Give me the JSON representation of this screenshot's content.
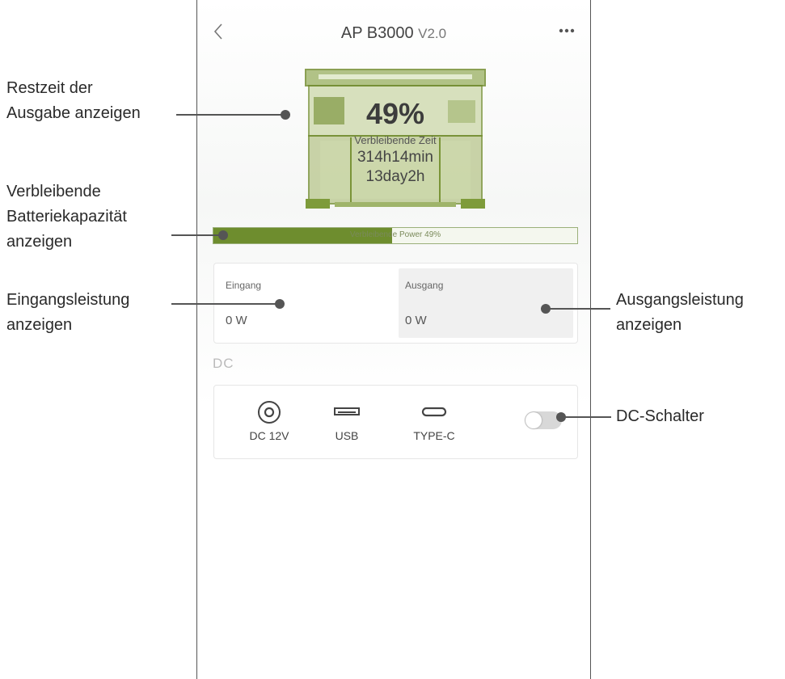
{
  "app": {
    "title": "AP B3000",
    "version": "V2.0",
    "back_icon": "chevron-left-icon",
    "more_icon": "more-dots-icon"
  },
  "device": {
    "percent": "49%",
    "remaining_label": "Verbleibende Zeit",
    "remaining_time": "314h14min",
    "remaining_days": "13day2h",
    "accent_color": "#7e9b3a"
  },
  "battery": {
    "bar_text": "Verbleibende Power 49%",
    "level_percent": 49,
    "fill_color": "#6e8d2e"
  },
  "io": {
    "input_label": "Eingang",
    "input_value": "0 W",
    "output_label": "Ausgang",
    "output_value": "0 W"
  },
  "dc": {
    "heading": "DC",
    "ports": [
      {
        "label": "DC 12V",
        "icon": "dc-port-icon"
      },
      {
        "label": "USB",
        "icon": "usb-port-icon"
      },
      {
        "label": "TYPE-C",
        "icon": "type-c-port-icon"
      }
    ],
    "switch_on": false
  },
  "annotations": {
    "restzeit_line1": "Restzeit der",
    "restzeit_line2": "Ausgabe anzeigen",
    "kapazitaet_line1": "Verbleibende",
    "kapazitaet_line2": "Batteriekapazität",
    "kapazitaet_line3": "anzeigen",
    "eingang_line1": "Eingangsleistung",
    "eingang_line2": "anzeigen",
    "ausgang_line1": "Ausgangsleistung",
    "ausgang_line2": "anzeigen",
    "dc_switch": "DC-Schalter"
  }
}
